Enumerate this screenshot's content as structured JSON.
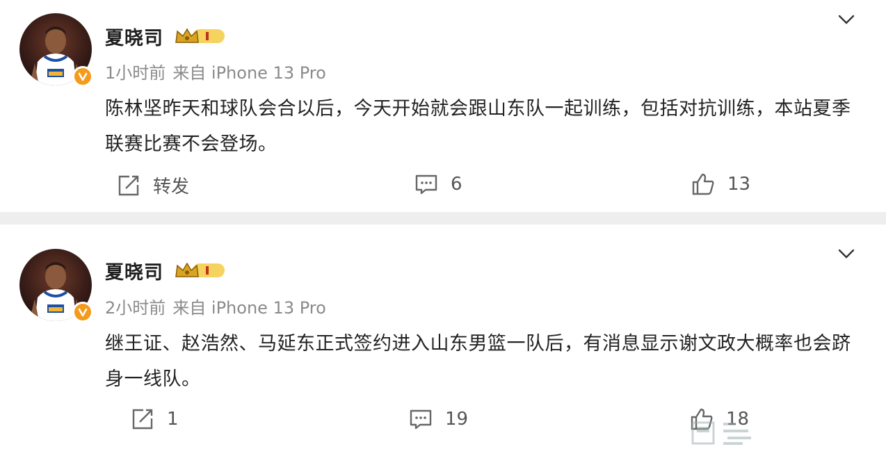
{
  "posts": [
    {
      "username": "夏晓司",
      "time": "1小时前",
      "source": "来自 iPhone 13 Pro",
      "text": "陈林坚昨天和球队会合以后，今天开始就会跟山东队一起训练，包括对抗训练，本站夏季联赛比赛不会登场。",
      "repost_label": "转发",
      "comment_count": "6",
      "like_count": "13"
    },
    {
      "username": "夏晓司",
      "time": "2小时前",
      "source": "来自 iPhone 13 Pro",
      "text": "继王证、赵浩然、马延东正式签约进入山东男篮一队后，有消息显示谢文政大概率也会跻身一线队。",
      "repost_label": "1",
      "comment_count": "19",
      "like_count": "18"
    }
  ],
  "icons": {
    "verified": "verified-badge-icon",
    "crown": "crown-level-icon",
    "chevron": "chevron-down-icon",
    "repost": "repost-icon",
    "comment": "comment-icon",
    "like": "thumbs-up-icon"
  },
  "colors": {
    "verified_badge": "#f59a1a",
    "crown_gold": "#d9a51f",
    "text": "#222222",
    "meta": "#8a8a8a"
  }
}
